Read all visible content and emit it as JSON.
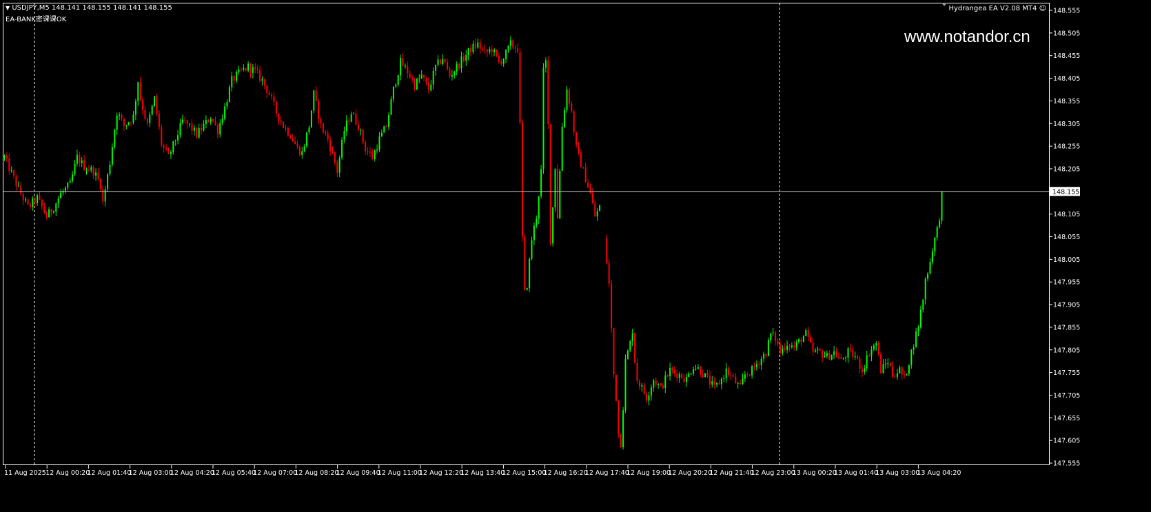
{
  "header": {
    "symbol_line": "USDJPY,M5  148.141 148.155 148.141 148.155",
    "ea_line": "EA-BANK密课课OK",
    "expert_name": "Hydrangea EA V2.08 MT4",
    "watermark": "www.notandor.cn"
  },
  "colors": {
    "background": "#000000",
    "bull": "#00ff00",
    "bear": "#ff0000",
    "axis": "#ffffff",
    "grid": "#ffffff"
  },
  "chart_data": {
    "type": "candlestick",
    "symbol": "USDJPY",
    "timeframe": "M5",
    "bid_line": 148.155,
    "ylim": [
      147.53,
      148.575
    ],
    "y_ticks": [
      "148.555",
      "148.505",
      "148.455",
      "148.405",
      "148.355",
      "148.305",
      "148.255",
      "148.205",
      "148.155",
      "148.105",
      "148.055",
      "148.005",
      "147.955",
      "147.905",
      "147.855",
      "147.805",
      "147.755",
      "147.705",
      "147.655",
      "147.605",
      "147.555"
    ],
    "x_ticks": [
      "11 Aug 2025",
      "12 Aug 00:20",
      "12 Aug 01:40",
      "12 Aug 03:00",
      "12 Aug 04:20",
      "12 Aug 05:40",
      "12 Aug 07:00",
      "12 Aug 08:20",
      "12 Aug 09:40",
      "12 Aug 11:00",
      "12 Aug 12:20",
      "12 Aug 13:40",
      "12 Aug 15:00",
      "12 Aug 16:20",
      "12 Aug 17:40",
      "12 Aug 19:00",
      "12 Aug 20:20",
      "12 Aug 21:40",
      "12 Aug 23:00",
      "13 Aug 00:20",
      "13 Aug 01:40",
      "13 Aug 03:00",
      "13 Aug 04:20"
    ],
    "period_separators": [
      "12 Aug 00:00",
      "13 Aug 00:00"
    ],
    "close_path": [
      [
        0,
        148.23
      ],
      [
        6,
        148.16
      ],
      [
        10,
        148.12
      ],
      [
        14,
        148.14
      ],
      [
        18,
        148.1
      ],
      [
        21,
        148.12
      ],
      [
        24,
        148.15
      ],
      [
        28,
        148.17
      ],
      [
        31,
        148.23
      ],
      [
        34,
        148.21
      ],
      [
        38,
        148.2
      ],
      [
        41,
        148.17
      ],
      [
        42,
        148.13
      ],
      [
        45,
        148.22
      ],
      [
        48,
        148.33
      ],
      [
        51,
        148.3
      ],
      [
        55,
        148.32
      ],
      [
        57,
        148.4
      ],
      [
        58,
        148.36
      ],
      [
        61,
        148.3
      ],
      [
        64,
        148.36
      ],
      [
        67,
        148.26
      ],
      [
        70,
        148.23
      ],
      [
        73,
        148.27
      ],
      [
        76,
        148.31
      ],
      [
        79,
        148.3
      ],
      [
        82,
        148.28
      ],
      [
        85,
        148.3
      ],
      [
        88,
        148.32
      ],
      [
        91,
        148.29
      ],
      [
        94,
        148.34
      ],
      [
        97,
        148.4
      ],
      [
        101,
        148.42
      ],
      [
        104,
        148.43
      ],
      [
        107,
        148.42
      ],
      [
        110,
        148.4
      ],
      [
        113,
        148.37
      ],
      [
        116,
        148.33
      ],
      [
        119,
        148.3
      ],
      [
        122,
        148.28
      ],
      [
        125,
        148.25
      ],
      [
        127,
        148.24
      ],
      [
        130,
        148.3
      ],
      [
        132,
        148.37
      ],
      [
        135,
        148.3
      ],
      [
        138,
        148.27
      ],
      [
        141,
        148.22
      ],
      [
        142,
        148.2
      ],
      [
        145,
        148.29
      ],
      [
        148,
        148.33
      ],
      [
        151,
        148.3
      ],
      [
        154,
        148.25
      ],
      [
        157,
        148.23
      ],
      [
        160,
        148.27
      ],
      [
        163,
        148.3
      ],
      [
        166,
        148.38
      ],
      [
        169,
        148.44
      ],
      [
        172,
        148.42
      ],
      [
        175,
        148.39
      ],
      [
        178,
        148.41
      ],
      [
        181,
        148.38
      ],
      [
        184,
        148.43
      ],
      [
        187,
        148.45
      ],
      [
        190,
        148.41
      ],
      [
        193,
        148.43
      ],
      [
        196,
        148.45
      ],
      [
        199,
        148.47
      ],
      [
        202,
        148.48
      ],
      [
        205,
        148.46
      ],
      [
        208,
        148.47
      ],
      [
        211,
        148.44
      ],
      [
        213,
        148.45
      ],
      [
        216,
        148.48
      ],
      [
        219,
        148.47
      ],
      [
        220,
        148.3
      ],
      [
        221,
        148.05
      ],
      [
        222,
        147.93
      ],
      [
        223,
        147.95
      ],
      [
        225,
        148.05
      ],
      [
        227,
        148.1
      ],
      [
        229,
        148.2
      ],
      [
        230,
        148.42
      ],
      [
        231,
        148.44
      ],
      [
        232,
        148.3
      ],
      [
        233,
        148.05
      ],
      [
        234,
        148.12
      ],
      [
        235,
        148.21
      ],
      [
        236,
        148.1
      ],
      [
        238,
        148.3
      ],
      [
        240,
        148.38
      ],
      [
        242,
        148.33
      ],
      [
        244,
        148.25
      ],
      [
        247,
        148.2
      ],
      [
        250,
        148.15
      ],
      [
        252,
        148.1
      ],
      [
        254,
        148.12
      ],
      [
        256,
        148.05
      ],
      [
        258,
        147.95
      ],
      [
        259,
        147.85
      ],
      [
        260,
        147.75
      ],
      [
        261,
        147.7
      ],
      [
        262,
        147.62
      ],
      [
        263,
        147.6
      ],
      [
        264,
        147.68
      ],
      [
        265,
        147.78
      ],
      [
        267,
        147.82
      ],
      [
        268,
        147.85
      ],
      [
        269,
        147.78
      ],
      [
        270,
        147.74
      ],
      [
        272,
        147.72
      ],
      [
        274,
        147.7
      ],
      [
        277,
        147.74
      ],
      [
        280,
        147.72
      ],
      [
        284,
        147.76
      ],
      [
        288,
        147.75
      ],
      [
        291,
        147.74
      ],
      [
        294,
        147.77
      ],
      [
        297,
        147.76
      ],
      [
        300,
        147.74
      ],
      [
        303,
        147.72
      ],
      [
        306,
        147.74
      ],
      [
        308,
        147.76
      ],
      [
        311,
        147.74
      ],
      [
        314,
        147.72
      ],
      [
        316,
        147.75
      ],
      [
        319,
        147.76
      ],
      [
        322,
        147.78
      ],
      [
        325,
        147.8
      ],
      [
        327,
        147.84
      ],
      [
        329,
        147.83
      ],
      [
        331,
        147.8
      ],
      [
        334,
        147.82
      ],
      [
        337,
        147.81
      ],
      [
        340,
        147.83
      ],
      [
        342,
        147.84
      ],
      [
        345,
        147.8
      ],
      [
        348,
        147.8
      ],
      [
        351,
        147.79
      ],
      [
        354,
        147.8
      ],
      [
        357,
        147.78
      ],
      [
        360,
        147.8
      ],
      [
        363,
        147.79
      ],
      [
        366,
        147.76
      ],
      [
        369,
        147.8
      ],
      [
        372,
        147.82
      ],
      [
        374,
        147.76
      ],
      [
        377,
        147.78
      ],
      [
        379,
        147.75
      ],
      [
        382,
        147.76
      ],
      [
        384,
        147.74
      ],
      [
        386,
        147.78
      ],
      [
        388,
        147.82
      ],
      [
        390,
        147.86
      ],
      [
        392,
        147.92
      ],
      [
        393,
        147.96
      ],
      [
        394,
        147.98
      ],
      [
        395,
        148.0
      ],
      [
        396,
        148.03
      ],
      [
        398,
        148.07
      ],
      [
        399,
        148.1
      ],
      [
        400,
        148.155
      ]
    ]
  }
}
